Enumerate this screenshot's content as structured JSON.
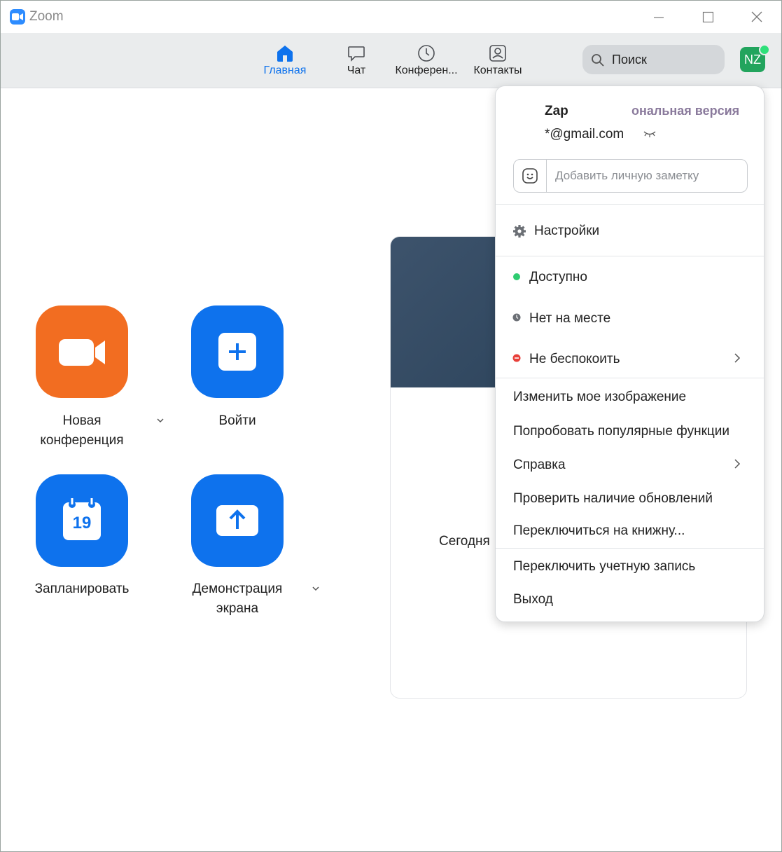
{
  "window": {
    "title": "Zoom"
  },
  "nav": {
    "tabs": [
      {
        "label": "Главная",
        "icon": "home-icon",
        "active": true
      },
      {
        "label": "Чат",
        "icon": "chat-icon",
        "active": false
      },
      {
        "label": "Конферен...",
        "icon": "clock-icon",
        "active": false
      },
      {
        "label": "Контакты",
        "icon": "contacts-icon",
        "active": false
      }
    ],
    "search_label": "Поиск",
    "avatar_initials": "NZ"
  },
  "home": {
    "new_meeting": "Новая конференция",
    "join": "Войти",
    "schedule": "Запланировать",
    "schedule_date": "19",
    "share_screen": "Демонстрация экрана",
    "today": "Сегодня"
  },
  "menu": {
    "name": "Zap",
    "plan": "ональная версия",
    "email": "*@gmail.com",
    "note_placeholder": "Добавить личную заметку",
    "settings": "Настройки",
    "status_available": "Доступно",
    "status_away": "Нет на месте",
    "status_dnd": "Не беспокоить",
    "change_picture": "Изменить мое изображение",
    "try_features": "Попробовать популярные функции",
    "help": "Справка",
    "check_updates": "Проверить наличие обновлений",
    "switch_portrait": "Переключиться на книжну...",
    "switch_account": "Переключить учетную запись",
    "logout": "Выход"
  },
  "colors": {
    "accent": "#0e72ed",
    "orange": "#f26d21",
    "available": "#2ecc71",
    "away": "#6b6f75",
    "dnd": "#e8403a"
  }
}
